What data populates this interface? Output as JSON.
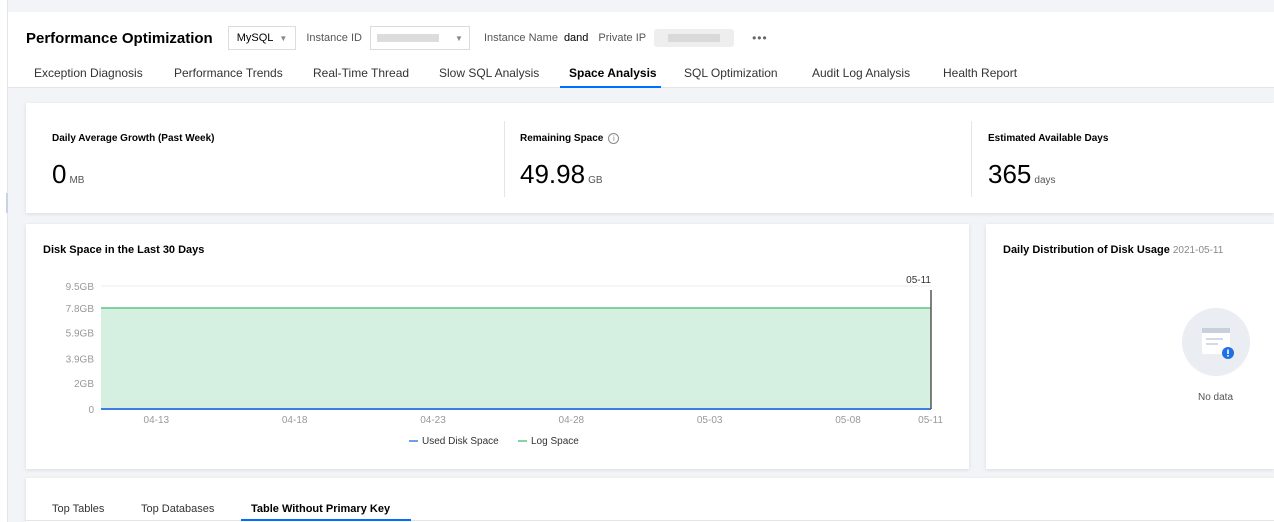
{
  "header": {
    "title": "Performance Optimization",
    "db_type": "MySQL",
    "instance_id_label": "Instance ID",
    "instance_name_label": "Instance Name",
    "instance_name_value": "dand",
    "private_ip_label": "Private IP",
    "more": "•••"
  },
  "tabs": [
    {
      "label": "Exception Diagnosis"
    },
    {
      "label": "Performance Trends"
    },
    {
      "label": "Real-Time Thread"
    },
    {
      "label": "Slow SQL Analysis"
    },
    {
      "label": "Space Analysis",
      "active": true
    },
    {
      "label": "SQL Optimization"
    },
    {
      "label": "Audit Log Analysis"
    },
    {
      "label": "Health Report"
    }
  ],
  "stats": [
    {
      "label": "Daily Average Growth (Past Week)",
      "value": "0",
      "unit": "MB"
    },
    {
      "label": "Remaining Space",
      "value": "49.98",
      "unit": "GB",
      "info_icon": "info-circle-icon"
    },
    {
      "label": "Estimated Available Days",
      "value": "365",
      "unit": "days"
    }
  ],
  "disk_chart": {
    "title": "Disk Space in the Last 30 Days"
  },
  "chart_data": {
    "type": "area",
    "title": "Disk Space in the Last 30 Days",
    "x_ticks": [
      "04-13",
      "04-18",
      "04-23",
      "04-28",
      "05-03",
      "05-08",
      "05-11"
    ],
    "y_ticks": [
      "0",
      "2GB",
      "3.9GB",
      "5.9GB",
      "7.8GB",
      "9.5GB"
    ],
    "y_tick_values": [
      0,
      2,
      3.9,
      5.9,
      7.8,
      9.5
    ],
    "ylim": [
      0,
      9.5
    ],
    "y_unit": "GB",
    "x_start": "04-11",
    "x_end": "05-11",
    "series": [
      {
        "name": "Used Disk Space",
        "color": "#3d7fe0",
        "constant_value": 0
      },
      {
        "name": "Log Space",
        "color": "#5cc784",
        "fill": "#d5efe0",
        "constant_value": 7.8
      }
    ],
    "highlight_label": "05-11",
    "legend_position": "bottom",
    "grid": true
  },
  "distribution": {
    "title": "Daily Distribution of Disk Usage",
    "date": "2021-05-11",
    "empty_text": "No data",
    "empty_icon": "empty-document-icon"
  },
  "bottom_tabs": [
    {
      "label": "Top Tables"
    },
    {
      "label": "Top Databases"
    },
    {
      "label": "Table Without Primary Key",
      "active": true
    }
  ]
}
